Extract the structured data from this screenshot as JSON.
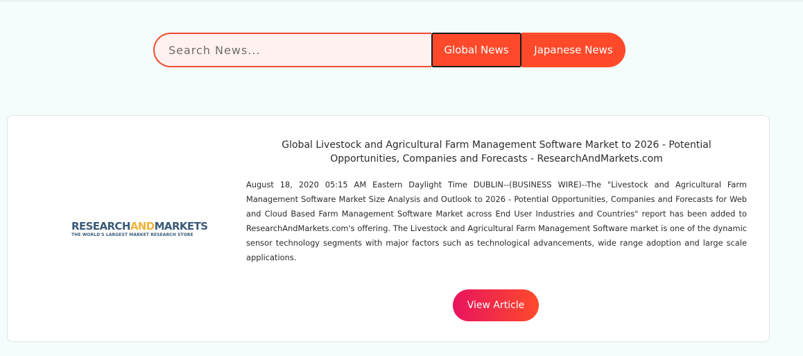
{
  "search": {
    "placeholder": "Search News...",
    "value": ""
  },
  "tabs": {
    "global_label": "Global News",
    "japanese_label": "Japanese News"
  },
  "article": {
    "logo": {
      "text_part1": "RESEARCH",
      "text_part2": "AND",
      "text_part3": "MARKETS",
      "tagline": "THE WORLD'S LARGEST MARKET RESEARCH STORE"
    },
    "title": "Global Livestock and Agricultural Farm Management Software Market to 2026 - Potential Opportunities, Companies and Forecasts - ResearchAndMarkets.com",
    "body": "August 18, 2020 05:15 AM Eastern Daylight Time DUBLIN--(BUSINESS WIRE)--The \"Livestock and Agricultural Farm Management Software Market Size Analysis and Outlook to 2026 - Potential Opportunities, Companies and Forecasts for Web and Cloud Based Farm Management Software Market across End User Industries and Countries\" report has been added to ResearchAndMarkets.com's offering. The Livestock and Agricultural Farm Management Software market is one of the dynamic sensor technology segments with major factors such as technological advancements, wide range adoption and large scale applications.",
    "view_button_label": "View Article"
  },
  "colors": {
    "accent": "#fe4a2b",
    "gradient_start": "#e8145f",
    "logo_blue": "#3a5a78",
    "logo_gold": "#f0b33a",
    "page_background": "#f4fdfb"
  }
}
